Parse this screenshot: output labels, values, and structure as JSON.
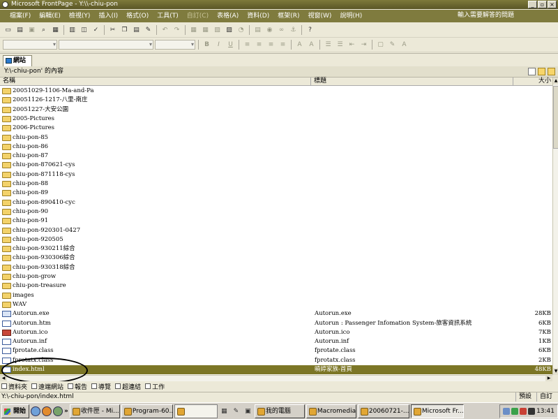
{
  "window": {
    "title": "Microsoft FrontPage - Y:\\\\-chiu-pon",
    "controls": [
      "_",
      "▫",
      "×"
    ]
  },
  "menu": {
    "items": [
      {
        "label": "檔案(F)",
        "enabled": true
      },
      {
        "label": "編輯(E)",
        "enabled": true
      },
      {
        "label": "檢視(Y)",
        "enabled": true
      },
      {
        "label": "插入(I)",
        "enabled": true
      },
      {
        "label": "格式(O)",
        "enabled": true
      },
      {
        "label": "工具(T)",
        "enabled": true
      },
      {
        "label": "自訂(C)",
        "enabled": false
      },
      {
        "label": "表格(A)",
        "enabled": true
      },
      {
        "label": "資料(D)",
        "enabled": true
      },
      {
        "label": "框架(R)",
        "enabled": true
      },
      {
        "label": "視窗(W)",
        "enabled": true
      },
      {
        "label": "說明(H)",
        "enabled": true
      }
    ],
    "help_placeholder": "輸入需要解答的問題"
  },
  "toolbar": {
    "format_buttons": [
      "B",
      "I",
      "U"
    ]
  },
  "view_tab": {
    "label": "網站"
  },
  "path": {
    "label": "Y:\\-chiu-pon' 的內容"
  },
  "columns": {
    "name": "名稱",
    "title": "標題",
    "size": "大小"
  },
  "files": [
    {
      "name": "20051029-1106-Ma-and-Pa",
      "title": "",
      "size": "",
      "type": "folder"
    },
    {
      "name": "20051126-1217-八里-南庄",
      "title": "",
      "size": "",
      "type": "folder"
    },
    {
      "name": "20051227-大安公園",
      "title": "",
      "size": "",
      "type": "folder"
    },
    {
      "name": "2005-Pictures",
      "title": "",
      "size": "",
      "type": "folder"
    },
    {
      "name": "2006-Pictures",
      "title": "",
      "size": "",
      "type": "folder"
    },
    {
      "name": "chiu-pon-85",
      "title": "",
      "size": "",
      "type": "folder"
    },
    {
      "name": "chiu-pon-86",
      "title": "",
      "size": "",
      "type": "folder"
    },
    {
      "name": "chiu-pon-87",
      "title": "",
      "size": "",
      "type": "folder"
    },
    {
      "name": "chiu-pon-870621-cys",
      "title": "",
      "size": "",
      "type": "folder"
    },
    {
      "name": "chiu-pon-871118-cys",
      "title": "",
      "size": "",
      "type": "folder"
    },
    {
      "name": "chiu-pon-88",
      "title": "",
      "size": "",
      "type": "folder"
    },
    {
      "name": "chiu-pon-89",
      "title": "",
      "size": "",
      "type": "folder"
    },
    {
      "name": "chiu-pon-890410-cyc",
      "title": "",
      "size": "",
      "type": "folder"
    },
    {
      "name": "chiu-pon-90",
      "title": "",
      "size": "",
      "type": "folder"
    },
    {
      "name": "chiu-pon-91",
      "title": "",
      "size": "",
      "type": "folder"
    },
    {
      "name": "chiu-pon-920301-0427",
      "title": "",
      "size": "",
      "type": "folder"
    },
    {
      "name": "chiu-pon-920505",
      "title": "",
      "size": "",
      "type": "folder"
    },
    {
      "name": "chiu-pon-930211綜合",
      "title": "",
      "size": "",
      "type": "folder"
    },
    {
      "name": "chiu-pon-930306綜合",
      "title": "",
      "size": "",
      "type": "folder"
    },
    {
      "name": "chiu-pon-930318綜合",
      "title": "",
      "size": "",
      "type": "folder"
    },
    {
      "name": "chiu-pon-grow",
      "title": "",
      "size": "",
      "type": "folder"
    },
    {
      "name": "chiu-pon-treasure",
      "title": "",
      "size": "",
      "type": "folder"
    },
    {
      "name": "images",
      "title": "",
      "size": "",
      "type": "folder"
    },
    {
      "name": "WAV",
      "title": "",
      "size": "",
      "type": "folder"
    },
    {
      "name": "Autorun.exe",
      "title": "Autorun.exe",
      "size": "28KB",
      "type": "exe"
    },
    {
      "name": "Autorun.htm",
      "title": "Autorun : Passenger Infomation System-旅客資訊系統",
      "size": "6KB",
      "type": "htm"
    },
    {
      "name": "Autorun.ico",
      "title": "Autorun.ico",
      "size": "7KB",
      "type": "ico"
    },
    {
      "name": "Autorun.inf",
      "title": "Autorun.inf",
      "size": "1KB",
      "type": "file"
    },
    {
      "name": "fprotate.class",
      "title": "fprotate.class",
      "size": "6KB",
      "type": "file"
    },
    {
      "name": "fprotatx.class",
      "title": "fprotatx.class",
      "size": "2KB",
      "type": "file"
    },
    {
      "name": "index.html",
      "title": "曉婷家族-首頁",
      "size": "48KB",
      "type": "htm",
      "selected": true
    }
  ],
  "views": [
    "資料夾",
    "遠端網站",
    "報告",
    "導覽",
    "超連結",
    "工作"
  ],
  "status": {
    "path": "Y:\\-chiu-pon/index.html",
    "mode1": "預設",
    "mode2": "自訂"
  },
  "taskbar": {
    "start": "開始",
    "tasks": [
      {
        "label": "收件匣 - Mi...",
        "active": false
      },
      {
        "label": "Program-60...",
        "active": false
      },
      {
        "label": "我的電腦",
        "active": false
      },
      {
        "label": "Macromedia...",
        "active": false
      },
      {
        "label": "20060721-...",
        "active": false
      },
      {
        "label": "Microsoft Fr...",
        "active": true
      }
    ],
    "clock": "13:41"
  },
  "colors": {
    "title_bar": "#6b6730",
    "menu_bar": "#7f7b3e",
    "selection": "#7c7626",
    "folder": "#f3d26a"
  }
}
